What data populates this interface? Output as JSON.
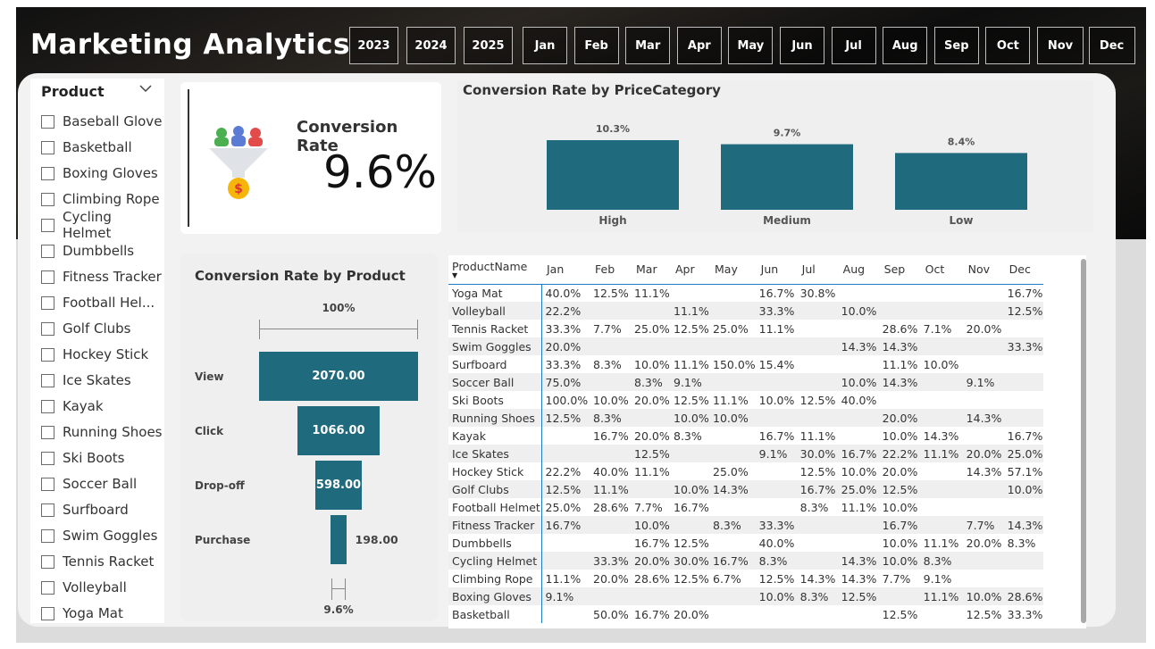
{
  "header": {
    "title": "Marketing Analytics",
    "year_buttons": [
      "2023",
      "2024",
      "2025"
    ],
    "month_buttons": [
      "Jan",
      "Feb",
      "Mar",
      "Apr",
      "May",
      "Jun",
      "Jul",
      "Aug",
      "Sep",
      "Oct",
      "Nov",
      "Dec"
    ]
  },
  "product_slicer": {
    "label": "Product",
    "items": [
      "Baseball Glove",
      "Basketball",
      "Boxing Gloves",
      "Climbing Rope",
      "Cycling Helmet",
      "Dumbbells",
      "Fitness Tracker",
      "Football Hel...",
      "Golf Clubs",
      "Hockey Stick",
      "Ice Skates",
      "Kayak",
      "Running Shoes",
      "Ski Boots",
      "Soccer Ball",
      "Surfboard",
      "Swim Goggles",
      "Tennis Racket",
      "Volleyball",
      "Yoga Mat"
    ]
  },
  "kpi": {
    "title": "Conversion Rate",
    "value": "9.6%",
    "icon": "funnel-coin-icon"
  },
  "colors": {
    "bar": "#206a7e",
    "accent": "#1f7bc4"
  },
  "chart_data": [
    {
      "type": "bar",
      "title": "Conversion Rate by PriceCategory",
      "categories": [
        "High",
        "Medium",
        "Low"
      ],
      "values": [
        10.3,
        9.7,
        8.4
      ],
      "labels": [
        "10.3%",
        "9.7%",
        "8.4%"
      ],
      "ylim": [
        0,
        10.3
      ]
    },
    {
      "type": "bar",
      "subtype": "funnel",
      "title": "Conversion Rate by Product",
      "categories": [
        "View",
        "Click",
        "Drop-off",
        "Purchase"
      ],
      "values": [
        2070,
        1066,
        598,
        198
      ],
      "labels": [
        "2070.00",
        "1066.00",
        "598.00",
        "198.00"
      ],
      "top_label": "100%",
      "bottom_label": "9.6%"
    }
  ],
  "matrix": {
    "headers": [
      "ProductName",
      "Jan",
      "Feb",
      "Mar",
      "Apr",
      "May",
      "Jun",
      "Jul",
      "Aug",
      "Sep",
      "Oct",
      "Nov",
      "Dec"
    ],
    "rows": [
      [
        "Yoga Mat",
        "40.0%",
        "12.5%",
        "11.1%",
        "",
        "",
        "16.7%",
        "30.8%",
        "",
        "",
        "",
        "",
        "16.7%"
      ],
      [
        "Volleyball",
        "22.2%",
        "",
        "",
        "11.1%",
        "",
        "33.3%",
        "",
        "10.0%",
        "",
        "",
        "",
        "12.5%"
      ],
      [
        "Tennis Racket",
        "33.3%",
        "7.7%",
        "25.0%",
        "12.5%",
        "25.0%",
        "11.1%",
        "",
        "",
        "28.6%",
        "7.1%",
        "20.0%",
        ""
      ],
      [
        "Swim Goggles",
        "20.0%",
        "",
        "",
        "",
        "",
        "",
        "",
        "14.3%",
        "14.3%",
        "",
        "",
        "33.3%"
      ],
      [
        "Surfboard",
        "33.3%",
        "8.3%",
        "10.0%",
        "11.1%",
        "150.0%",
        "15.4%",
        "",
        "",
        "11.1%",
        "10.0%",
        "",
        ""
      ],
      [
        "Soccer Ball",
        "75.0%",
        "",
        "8.3%",
        "9.1%",
        "",
        "",
        "",
        "10.0%",
        "14.3%",
        "",
        "9.1%",
        ""
      ],
      [
        "Ski Boots",
        "100.0%",
        "10.0%",
        "20.0%",
        "12.5%",
        "11.1%",
        "10.0%",
        "12.5%",
        "40.0%",
        "",
        "",
        "",
        ""
      ],
      [
        "Running Shoes",
        "12.5%",
        "8.3%",
        "",
        "10.0%",
        "10.0%",
        "",
        "",
        "",
        "20.0%",
        "",
        "14.3%",
        ""
      ],
      [
        "Kayak",
        "",
        "16.7%",
        "20.0%",
        "8.3%",
        "",
        "16.7%",
        "11.1%",
        "",
        "10.0%",
        "14.3%",
        "",
        "16.7%"
      ],
      [
        "Ice Skates",
        "",
        "",
        "12.5%",
        "",
        "",
        "9.1%",
        "30.0%",
        "16.7%",
        "22.2%",
        "11.1%",
        "20.0%",
        "25.0%"
      ],
      [
        "Hockey Stick",
        "22.2%",
        "40.0%",
        "11.1%",
        "",
        "25.0%",
        "",
        "12.5%",
        "10.0%",
        "20.0%",
        "",
        "14.3%",
        "57.1%"
      ],
      [
        "Golf Clubs",
        "12.5%",
        "11.1%",
        "",
        "10.0%",
        "14.3%",
        "",
        "16.7%",
        "25.0%",
        "12.5%",
        "",
        "",
        "10.0%"
      ],
      [
        "Football Helmet",
        "25.0%",
        "28.6%",
        "7.7%",
        "16.7%",
        "",
        "",
        "8.3%",
        "11.1%",
        "10.0%",
        "",
        "",
        ""
      ],
      [
        "Fitness Tracker",
        "16.7%",
        "",
        "10.0%",
        "",
        "8.3%",
        "33.3%",
        "",
        "",
        "16.7%",
        "",
        "7.7%",
        "14.3%"
      ],
      [
        "Dumbbells",
        "",
        "",
        "16.7%",
        "12.5%",
        "",
        "40.0%",
        "",
        "",
        "10.0%",
        "11.1%",
        "20.0%",
        "8.3%"
      ],
      [
        "Cycling Helmet",
        "",
        "33.3%",
        "20.0%",
        "30.0%",
        "16.7%",
        "8.3%",
        "",
        "14.3%",
        "10.0%",
        "8.3%",
        "",
        ""
      ],
      [
        "Climbing Rope",
        "11.1%",
        "20.0%",
        "28.6%",
        "12.5%",
        "6.7%",
        "12.5%",
        "14.3%",
        "14.3%",
        "7.7%",
        "9.1%",
        "",
        ""
      ],
      [
        "Boxing Gloves",
        "9.1%",
        "",
        "",
        "",
        "",
        "10.0%",
        "8.3%",
        "12.5%",
        "",
        "11.1%",
        "10.0%",
        "28.6%"
      ],
      [
        "Basketball",
        "",
        "50.0%",
        "16.7%",
        "20.0%",
        "",
        "",
        "",
        "",
        "12.5%",
        "",
        "12.5%",
        "33.3%"
      ]
    ]
  }
}
